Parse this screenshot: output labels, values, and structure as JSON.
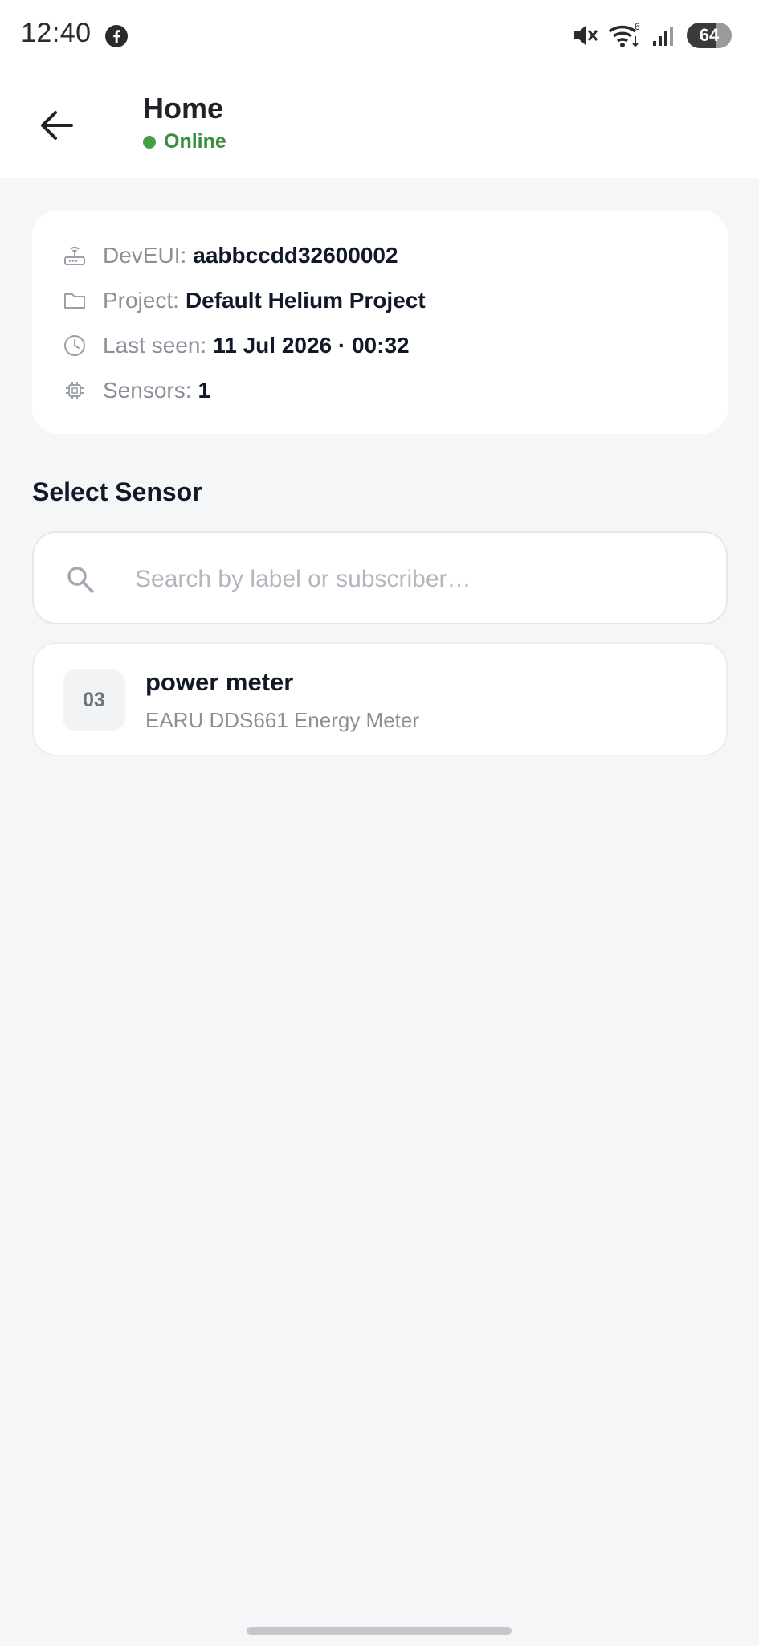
{
  "status_bar": {
    "time": "12:40",
    "wifi_badge": "6",
    "battery": "64",
    "icons": [
      "facebook-icon",
      "mute-icon",
      "wifi-icon",
      "signal-icon",
      "battery-icon"
    ]
  },
  "header": {
    "title": "Home",
    "status": "Online",
    "status_color": "#43a047",
    "back_icon": "arrow-left-icon"
  },
  "device_info": {
    "deveui_label": "DevEUI:",
    "deveui_value": "aabbccdd32600002",
    "project_label": "Project:",
    "project_value": "Default Helium Project",
    "last_seen_label": "Last seen:",
    "last_seen_value": "11 Jul 2026 · 00:32",
    "sensors_label": "Sensors:",
    "sensors_value": "1"
  },
  "sensor_section": {
    "title": "Select Sensor",
    "search_placeholder": "Search by label or subscriber…",
    "search_value": "",
    "items": [
      {
        "badge": "03",
        "name": "power meter",
        "subtitle": "EARU DDS661 Energy Meter"
      }
    ]
  }
}
